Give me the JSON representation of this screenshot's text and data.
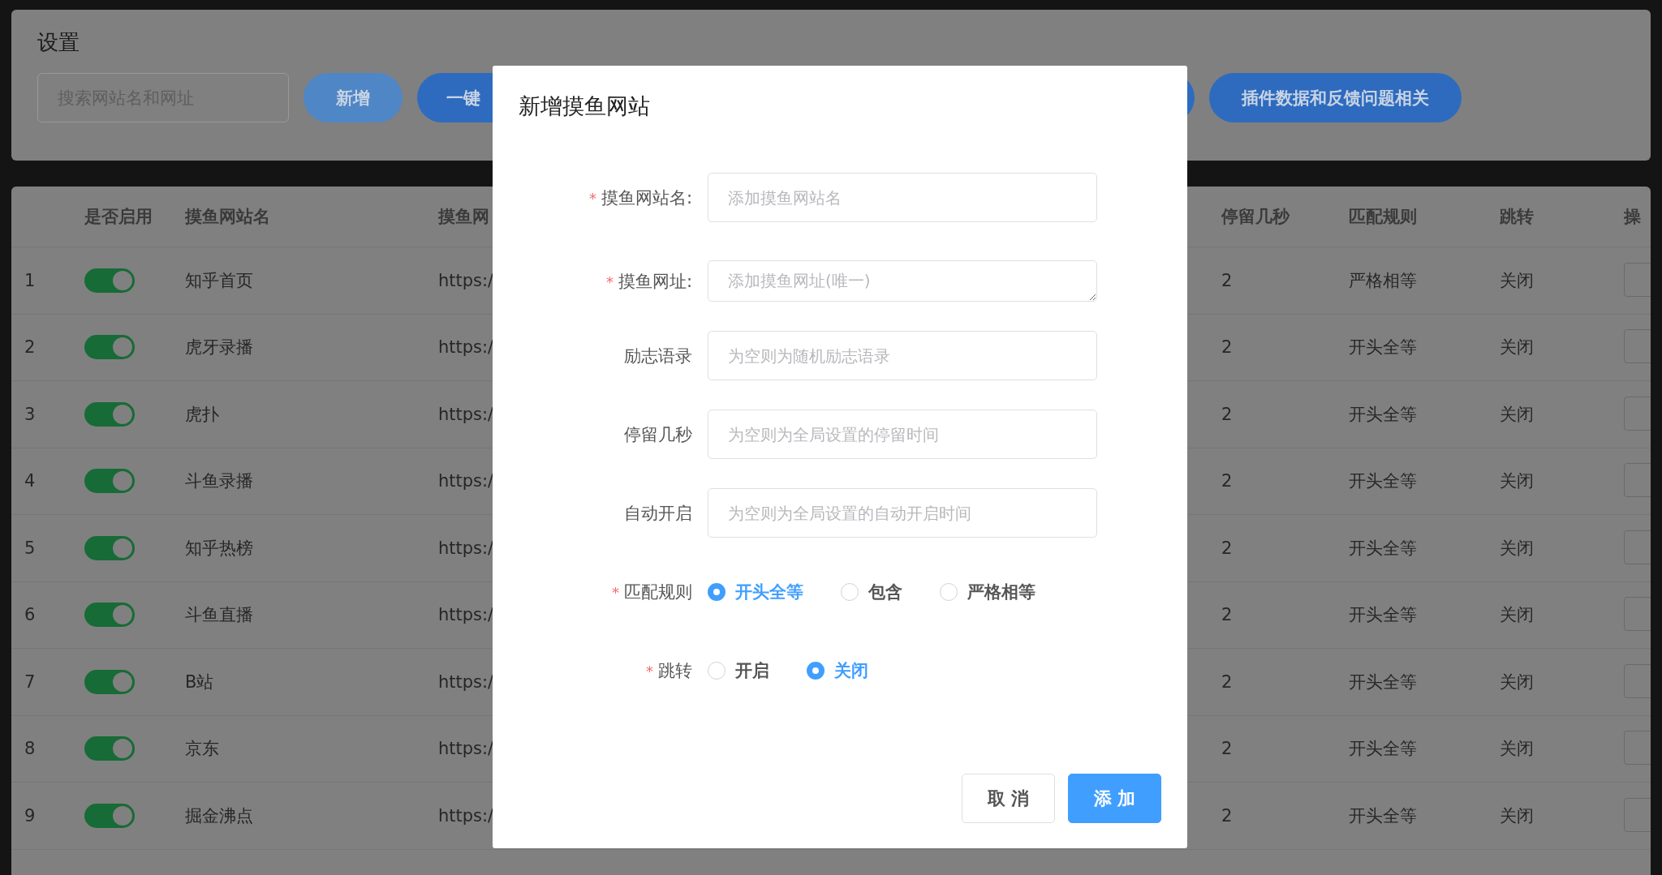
{
  "page_title": "设置",
  "search": {
    "placeholder": "搜索网站名和网址"
  },
  "toolbar_buttons": [
    {
      "label": "新增",
      "kind": "light"
    },
    {
      "label": "一键",
      "kind": "solid"
    },
    {
      "label": "插件数据和反馈问题相关",
      "kind": "solid"
    }
  ],
  "table": {
    "columns": [
      "是否启用",
      "摸鱼网站名",
      "摸鱼网",
      "停留几秒",
      "匹配规则",
      "跳转",
      "操"
    ],
    "rows": [
      {
        "index": "1",
        "enabled": true,
        "name": "知乎首页",
        "url": "https:/",
        "stay": "2",
        "rule": "严格相等",
        "jump": "关闭"
      },
      {
        "index": "2",
        "enabled": true,
        "name": "虎牙录播",
        "url": "https:/",
        "stay": "2",
        "rule": "开头全等",
        "jump": "关闭"
      },
      {
        "index": "3",
        "enabled": true,
        "name": "虎扑",
        "url": "https:/",
        "stay": "2",
        "rule": "开头全等",
        "jump": "关闭"
      },
      {
        "index": "4",
        "enabled": true,
        "name": "斗鱼录播",
        "url": "https:/",
        "stay": "2",
        "rule": "开头全等",
        "jump": "关闭"
      },
      {
        "index": "5",
        "enabled": true,
        "name": "知乎热榜",
        "url": "https:/",
        "stay": "2",
        "rule": "开头全等",
        "jump": "关闭"
      },
      {
        "index": "6",
        "enabled": true,
        "name": "斗鱼直播",
        "url": "https:/",
        "stay": "2",
        "rule": "开头全等",
        "jump": "关闭"
      },
      {
        "index": "7",
        "enabled": true,
        "name": "B站",
        "url": "https:/",
        "stay": "2",
        "rule": "开头全等",
        "jump": "关闭"
      },
      {
        "index": "8",
        "enabled": true,
        "name": "京东",
        "url": "https:/",
        "stay": "2",
        "rule": "开头全等",
        "jump": "关闭"
      },
      {
        "index": "9",
        "enabled": true,
        "name": "掘金沸点",
        "url": "https:/",
        "stay": "2",
        "rule": "开头全等",
        "jump": "关闭"
      }
    ]
  },
  "dialog": {
    "title": "新增摸鱼网站",
    "fields": [
      {
        "label": "摸鱼网站名:",
        "required_mark": "*",
        "kind": "input",
        "placeholder": "添加摸鱼网站名"
      },
      {
        "label": "摸鱼网址:",
        "required_mark": "*",
        "kind": "textarea",
        "placeholder": "添加摸鱼网址(唯一)"
      },
      {
        "label": "励志语录",
        "kind": "input",
        "placeholder": "为空则为随机励志语录"
      },
      {
        "label": "停留几秒",
        "kind": "input",
        "placeholder": "为空则为全局设置的停留时间"
      },
      {
        "label": "自动开启",
        "kind": "input",
        "placeholder": "为空则为全局设置的自动开启时间"
      },
      {
        "label": "匹配规则",
        "required_mark": "*",
        "kind": "radio",
        "options": [
          {
            "label": "开头全等",
            "selected": true
          },
          {
            "label": "包含",
            "selected": false
          },
          {
            "label": "严格相等",
            "selected": false
          }
        ]
      },
      {
        "label": "跳转",
        "required_mark": "*",
        "kind": "radio",
        "options": [
          {
            "label": "开启",
            "selected": false
          },
          {
            "label": "关闭",
            "selected": true
          }
        ]
      }
    ],
    "buttons": [
      {
        "label": "取 消",
        "kind": "default"
      },
      {
        "label": "添 加",
        "kind": "primary"
      }
    ]
  }
}
